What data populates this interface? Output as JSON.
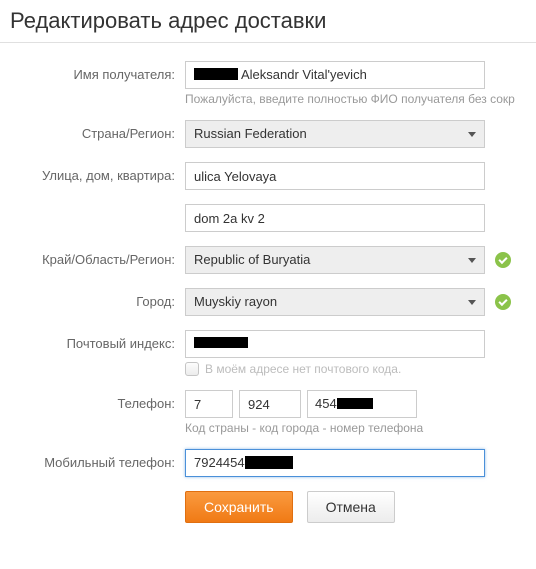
{
  "title": "Редактировать адрес доставки",
  "labels": {
    "recipient": "Имя получателя:",
    "country": "Страна/Регион:",
    "street": "Улица, дом, квартира:",
    "region": "Край/Область/Регион:",
    "city": "Город:",
    "postcode": "Почтовый индекс:",
    "phone": "Телефон:",
    "mobile": "Мобильный телефон:"
  },
  "values": {
    "recipient_suffix": "Aleksandr Vital'yevich",
    "country": "Russian Federation",
    "street1": "ulica Yelovaya",
    "street2": "dom 2a kv 2",
    "region": "Republic of Buryatia",
    "city": "Muyskiy rayon",
    "postcode": "",
    "phone_country": "7",
    "phone_area": "924",
    "phone_number_prefix": "454",
    "mobile_prefix": "7924454"
  },
  "help": {
    "recipient": "Пожалуйста, введите полностью ФИО получателя без сокр",
    "no_postcode": "В моём адресе нет почтового кода.",
    "phone": "Код страны - код города - номер телефона"
  },
  "buttons": {
    "save": "Сохранить",
    "cancel": "Отмена"
  }
}
